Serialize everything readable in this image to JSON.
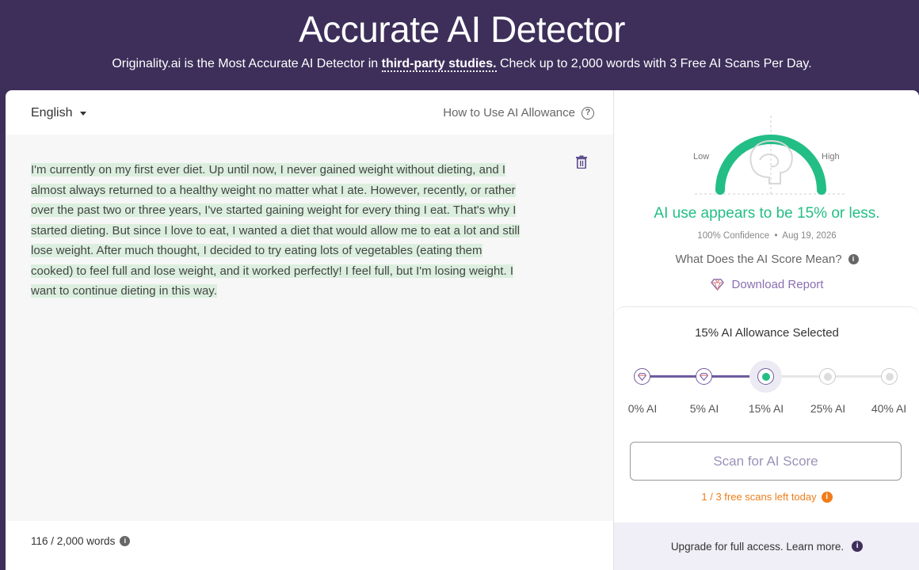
{
  "hero": {
    "title": "Accurate AI Detector",
    "subtitle_before": "Originality.ai is the Most Accurate AI Detector in ",
    "subtitle_link": "third-party studies.",
    "subtitle_after": " Check up to 2,000 words with 3 Free AI Scans Per Day."
  },
  "editor": {
    "language": "English",
    "how_to": "How to Use AI Allowance",
    "lines": [
      "I'm currently on my first ever diet. Up until now, I never gained weight without dieting, and I",
      "almost always returned to a healthy weight no matter what I ate. However, recently, or rather",
      "over the past two or three years, I've started gaining weight for every thing I eat. That's why I",
      "started dieting. But since I love to eat, I wanted a diet that would allow me to eat a lot and still",
      "lose weight. After much thought, I decided to try eating lots of vegetables (eating them",
      "cooked) to feel full and lose weight, and it worked perfectly! I feel full, but I'm losing weight. I",
      "want to continue dieting in this way."
    ],
    "word_count": "116 / 2,000 words"
  },
  "result": {
    "gauge_low": "Low",
    "gauge_high": "High",
    "gauge_level": 0.15,
    "headline": "AI use appears to be 15% or less.",
    "confidence": "100% Confidence",
    "date": "Aug 19, 2026",
    "score_meaning": "What Does the AI Score Mean?",
    "download": "Download Report"
  },
  "allowance": {
    "title": "15% AI Allowance Selected",
    "options": [
      "0% AI",
      "5% AI",
      "15% AI",
      "25% AI",
      "40% AI"
    ],
    "selected_index": 2,
    "scan_button": "Scan for AI Score",
    "free_scans": "1 / 3 free scans left today",
    "upgrade": "Upgrade for full access. Learn more."
  },
  "colors": {
    "brand": "#3d2f5a",
    "accent_green": "#23be85",
    "accent_purple": "#6e5c9e",
    "warning_orange": "#f07c1a",
    "highlight": "#dcefdf"
  }
}
